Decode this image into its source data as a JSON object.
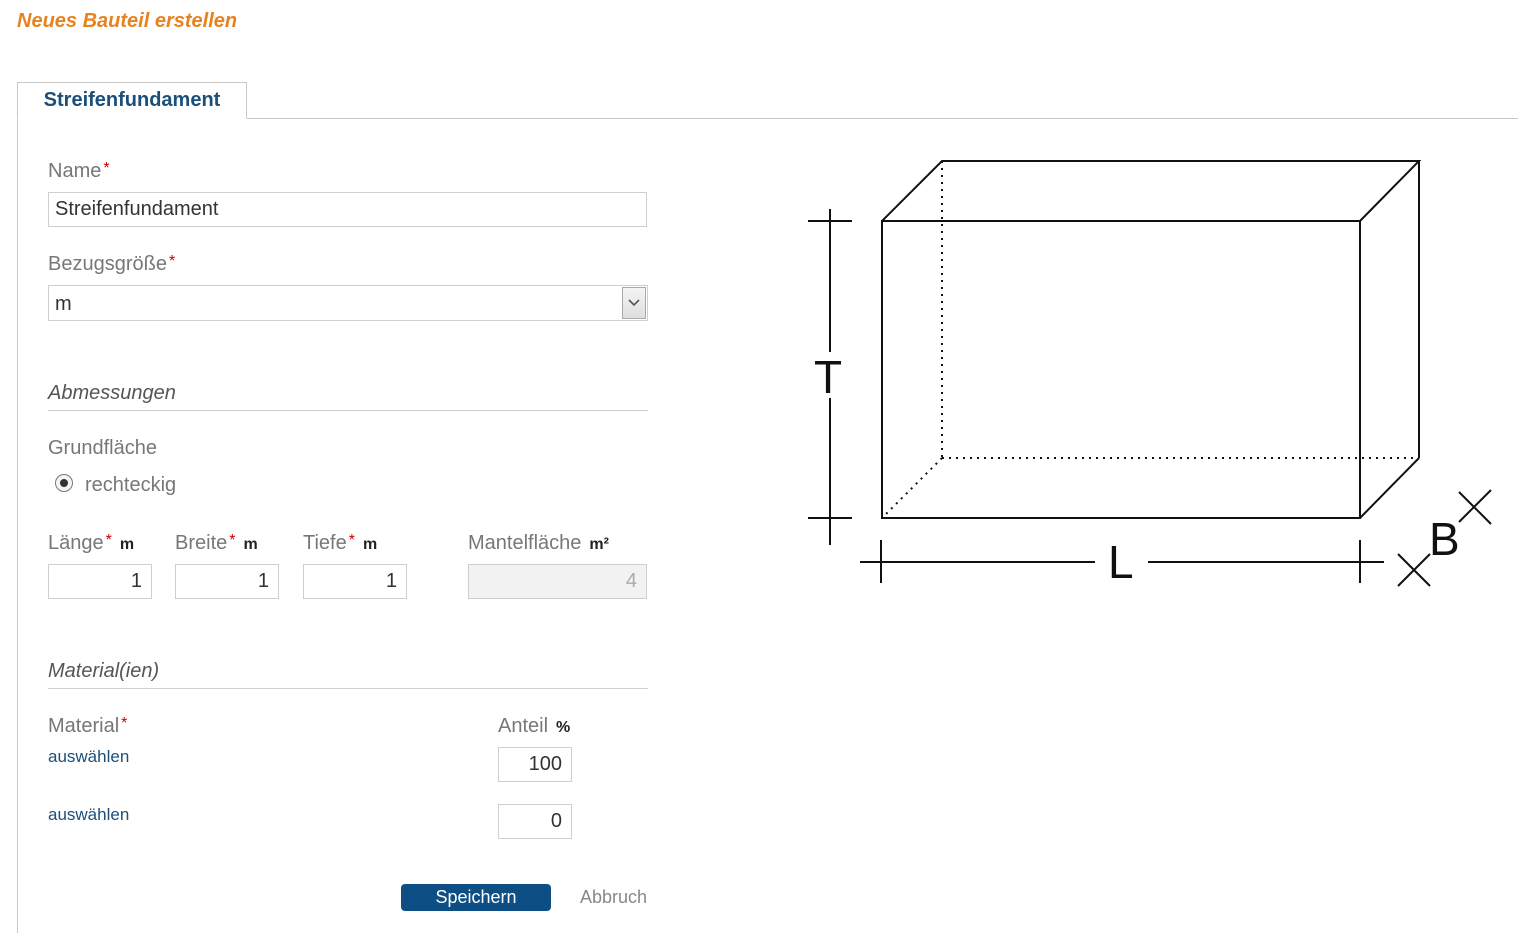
{
  "page_title": "Neues Bauteil erstellen",
  "tab": {
    "label": "Streifenfundament"
  },
  "form": {
    "name": {
      "label": "Name",
      "required_mark": "*",
      "value": "Streifenfundament"
    },
    "bezugsgroesse": {
      "label": "Bezugsgröße",
      "required_mark": "*",
      "selected": "m"
    },
    "abmessungen": {
      "title": "Abmessungen"
    },
    "grundflaeche": {
      "label": "Grundfläche",
      "option_selected": "rechteckig"
    },
    "laenge": {
      "label": "Länge",
      "required_mark": "*",
      "unit": "m",
      "value": "1"
    },
    "breite": {
      "label": "Breite",
      "required_mark": "*",
      "unit": "m",
      "value": "1"
    },
    "tiefe": {
      "label": "Tiefe",
      "required_mark": "*",
      "unit": "m",
      "value": "1"
    },
    "mantelflaeche": {
      "label": "Mantelfläche",
      "unit": "m²",
      "value": "4"
    },
    "materialien": {
      "title": "Material(ien)"
    },
    "material": {
      "label": "Material",
      "required_mark": "*"
    },
    "anteil": {
      "label": "Anteil",
      "unit": "%"
    },
    "material_rows": [
      {
        "link": "auswählen",
        "anteil": "100"
      },
      {
        "link": "auswählen",
        "anteil": "0"
      }
    ]
  },
  "buttons": {
    "save": "Speichern",
    "cancel": "Abbruch"
  },
  "diagram": {
    "label_t": "T",
    "label_l": "L",
    "label_b": "B"
  },
  "colors": {
    "title": "#e8821e",
    "tab_text": "#1b4f7a",
    "primary_button": "#0d4f84",
    "link": "#1b4f7a",
    "required": "#cc0000"
  }
}
